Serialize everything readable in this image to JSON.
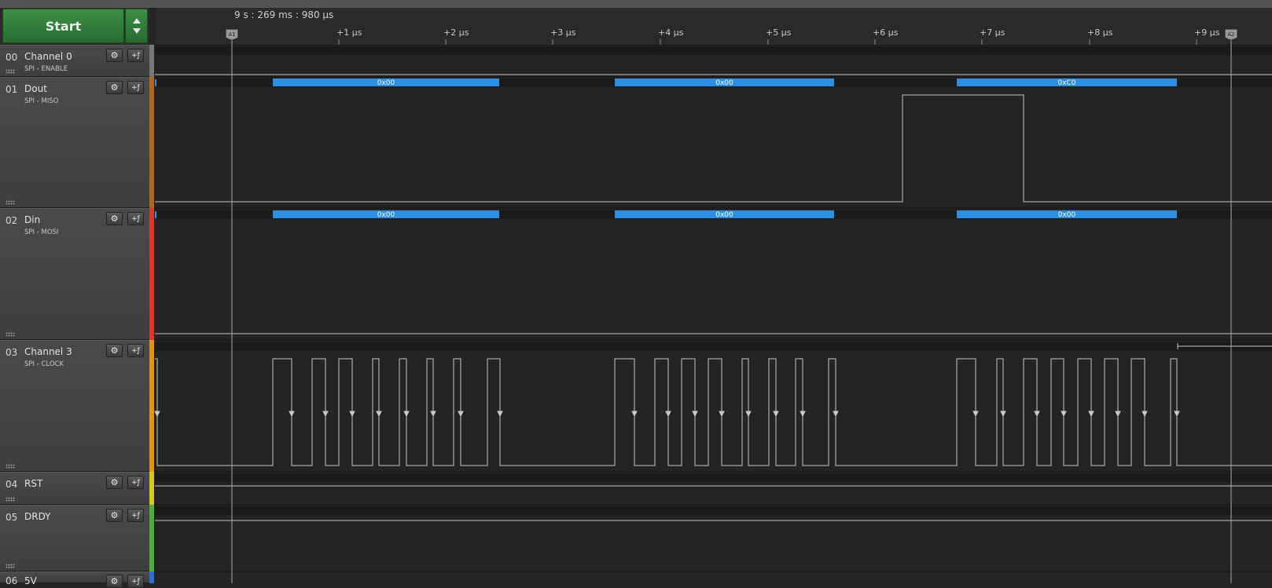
{
  "toolbar": {
    "start_label": "Start",
    "collapse_icon": "triangle-up-down-icon"
  },
  "timeline": {
    "timestamp": "9 s : 269 ms : 980 µs",
    "ticks": [
      "+1 µs",
      "+2 µs",
      "+3 µs",
      "+4 µs",
      "+5 µs",
      "+6 µs",
      "+7 µs",
      "+8 µs",
      "+9 µs"
    ],
    "markers": [
      "A1",
      "A2"
    ]
  },
  "channels": [
    {
      "num": "00",
      "name": "Channel 0",
      "sub": "SPI - ENABLE",
      "color": "#777777"
    },
    {
      "num": "01",
      "name": "Dout",
      "sub": "SPI - MISO",
      "color": "#b5651d"
    },
    {
      "num": "02",
      "name": "Din",
      "sub": "SPI - MOSI",
      "color": "#d83a2a"
    },
    {
      "num": "03",
      "name": "Channel 3",
      "sub": "SPI - CLOCK",
      "color": "#e8901a"
    },
    {
      "num": "04",
      "name": "RST",
      "sub": "",
      "color": "#d8c81a"
    },
    {
      "num": "05",
      "name": "DRDY",
      "sub": "",
      "color": "#4caf3a"
    },
    {
      "num": "06",
      "name": "5V",
      "sub": "",
      "color": "#2a6fd8"
    }
  ],
  "decoded": {
    "miso": [
      "0x00",
      "0x00",
      "0xC0"
    ],
    "mosi": [
      "0x00",
      "0x00",
      "0x00"
    ]
  },
  "colors": {
    "decode_bar": "#2e8fe2",
    "accent_start": "#2f7c3a",
    "waveform": "#c8c8c8"
  }
}
